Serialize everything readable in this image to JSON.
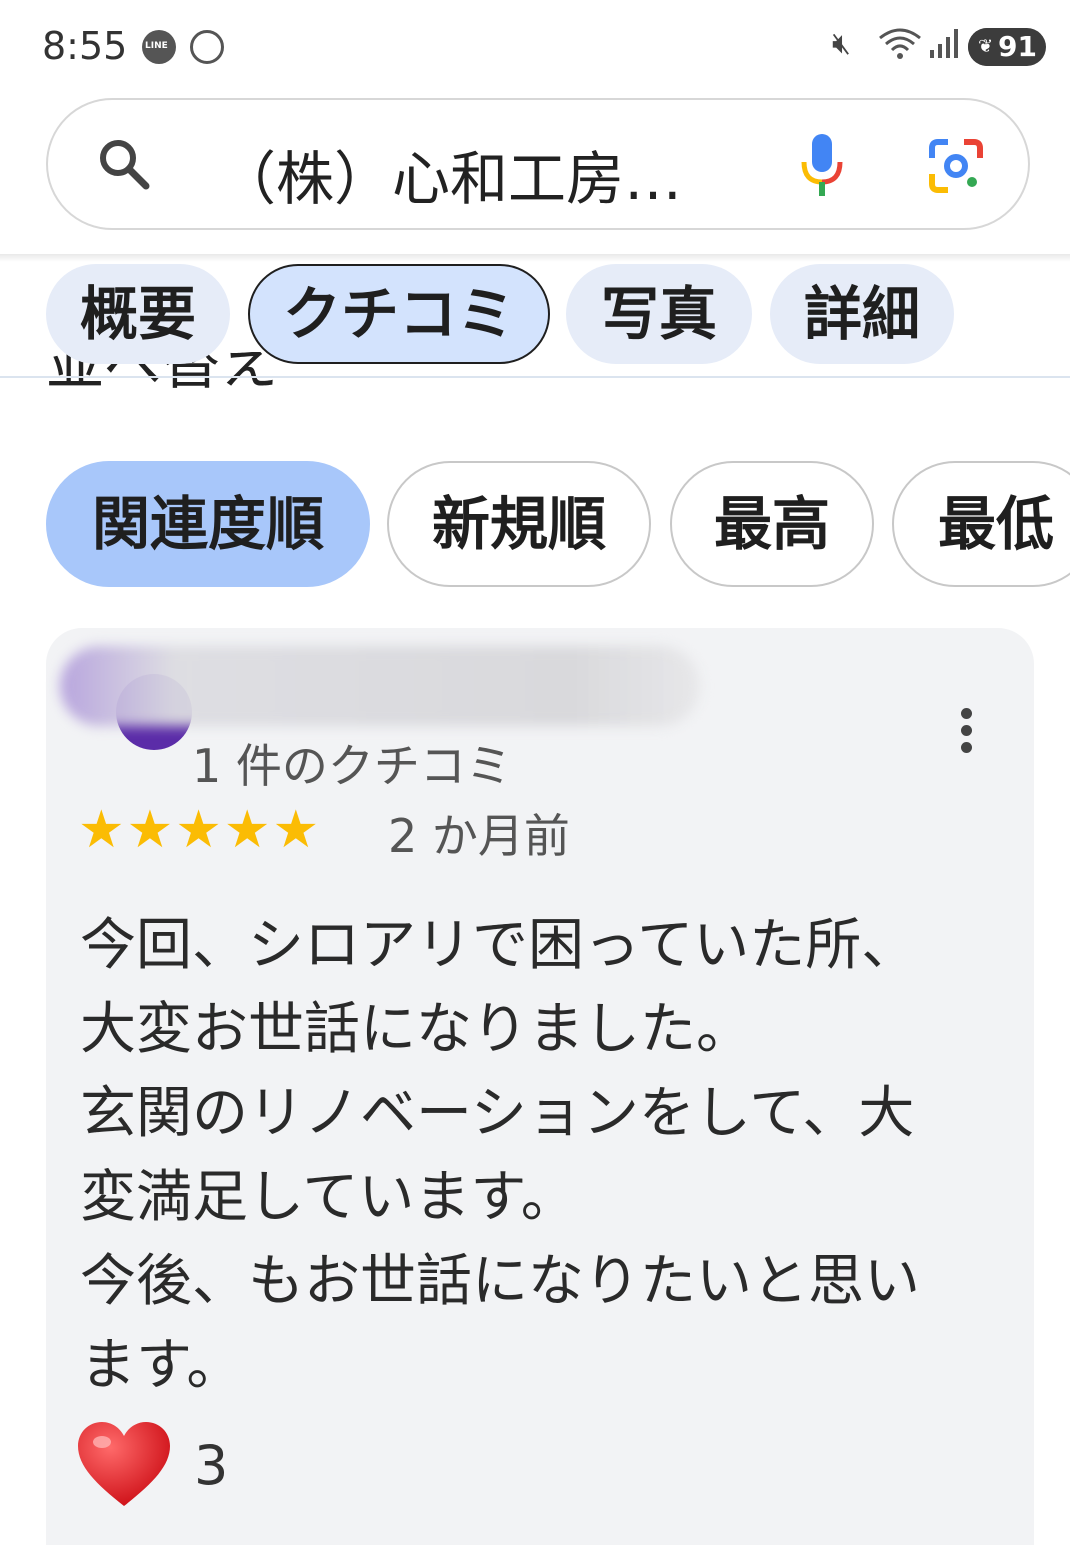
{
  "status_bar": {
    "time": "8:55",
    "battery": "91",
    "battery_level": 0.91,
    "icons": [
      "line-icon",
      "app-icon",
      "mute-icon",
      "wifi-icon",
      "signal-icon",
      "battery-icon"
    ]
  },
  "search": {
    "query": "（株）心和工房…"
  },
  "tabs": [
    {
      "label": "概要"
    },
    {
      "label": "クチコミ",
      "selected": true
    },
    {
      "label": "写真"
    },
    {
      "label": "詳細"
    }
  ],
  "sort_chips": [
    {
      "label": "関連度順",
      "selected": true
    },
    {
      "label": "新規順"
    },
    {
      "label": "最高"
    },
    {
      "label": "最低"
    }
  ],
  "review": {
    "reviewer_review_count": "1 件のクチコミ",
    "rating": 5,
    "stars": "★★★★★",
    "date": "2 か月前",
    "body_lines": [
      "今回、シロアリで困っていた所、",
      "大変お世話になりました。",
      "玄関のリノベーションをして、大",
      "変満足しています。",
      "今後、もお世話になりたいと思い",
      "ます。"
    ],
    "reaction_count": "3"
  },
  "colors": {
    "selected_chip": "#a8c7fa",
    "selected_tab": "#d3e3fd",
    "tab_bg": "#e6ecf8",
    "star": "#fbbc04",
    "card_bg": "#f2f3f5"
  }
}
